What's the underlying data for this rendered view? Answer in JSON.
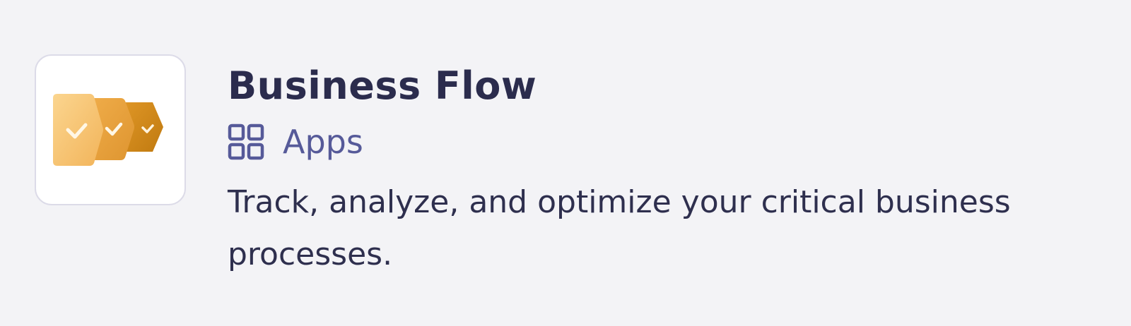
{
  "app": {
    "logo_icon": "business-flow-chevron-stages-icon",
    "title": "Business Flow",
    "category": {
      "icon": "apps-grid-icon",
      "label": "Apps"
    },
    "description": "Track, analyze, and optimize your critical business processes."
  },
  "colors": {
    "background": "#f3f3f6",
    "title": "#2b2c4d",
    "category": "#565a99",
    "logo_light": "#f8c77c",
    "logo_mid": "#eda73f",
    "logo_dark": "#d1880e"
  }
}
